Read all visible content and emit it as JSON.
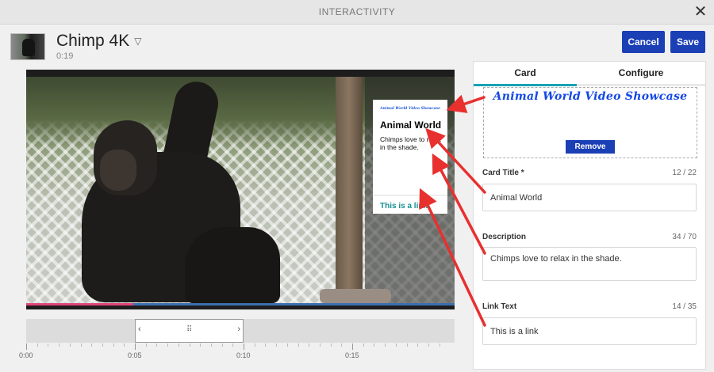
{
  "window": {
    "title": "INTERACTIVITY",
    "close_icon": "close-icon"
  },
  "video": {
    "title": "Chimp 4K",
    "duration": "0:19",
    "title_dropdown_icon": "triangle-down-icon"
  },
  "actions": {
    "cancel_label": "Cancel",
    "save_label": "Save"
  },
  "card_preview": {
    "logo_text": "Animal World Video Showcase",
    "title": "Animal World",
    "description": "Chimps love to relax in the shade.",
    "link_text": "This is a link"
  },
  "timeline": {
    "labels": [
      "0:00",
      "0:05",
      "0:10",
      "0:15"
    ],
    "range_left_icon": "chevron-left-icon",
    "range_right_icon": "chevron-right-icon",
    "range_grip_icon": "drag-grip-icon",
    "range_left_glyph": "‹",
    "range_right_glyph": "›",
    "range_grip_glyph": "⠿"
  },
  "panel": {
    "tabs": [
      {
        "label": "Card"
      },
      {
        "label": "Configure"
      }
    ],
    "active_tab": "Card",
    "image_logo_text": "Animal World Video Showcase",
    "remove_label": "Remove",
    "fields": {
      "card_title": {
        "label": "Card Title *",
        "count": "12 / 22",
        "value": "Animal World"
      },
      "description": {
        "label": "Description",
        "count": "34 / 70",
        "value": "Chimps love to relax in the shade."
      },
      "link_text": {
        "label": "Link Text",
        "count": "14 / 35",
        "value": "This is a link"
      }
    }
  },
  "colors": {
    "primary_button": "#1b3fb5",
    "tab_accent": "#17a2b8",
    "link": "#17908f",
    "annotation_arrow": "#e8302f"
  }
}
